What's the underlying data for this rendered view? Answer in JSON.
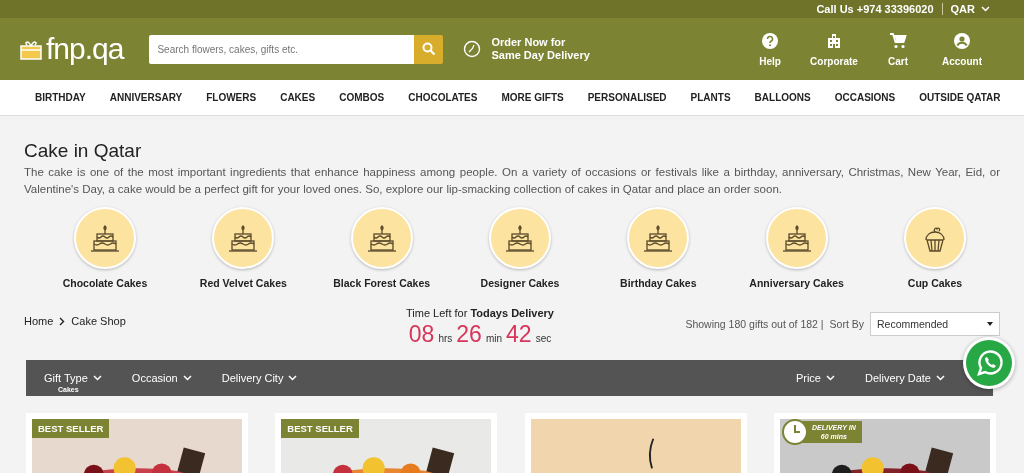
{
  "top_bar": {
    "call": "Call Us +974 33396020",
    "currency": "QAR"
  },
  "header": {
    "logo": "fnp.qa",
    "search": {
      "placeholder": "Search flowers, cakes, gifts etc."
    },
    "delivery_note": [
      "Order Now for",
      "Same Day Delivery"
    ],
    "actions": [
      {
        "kind": "help",
        "label": "Help"
      },
      {
        "kind": "corporate",
        "label": "Corporate"
      },
      {
        "kind": "cart",
        "label": "Cart"
      },
      {
        "kind": "account",
        "label": "Account"
      }
    ]
  },
  "nav": [
    "BIRTHDAY",
    "ANNIVERSARY",
    "FLOWERS",
    "CAKES",
    "COMBOS",
    "CHOCOLATES",
    "MORE GIFTS",
    "PERSONALISED",
    "PLANTS",
    "BALLOONS",
    "OCCASIONS",
    "OUTSIDE QATAR"
  ],
  "page": {
    "title": "Cake in Qatar",
    "description": "The cake is one of the most important ingredients that enhance happiness among people. On a variety of occasions or festivals like a birthday, anniversary, Christmas, New Year, Eid, or Valentine's Day, a cake would be a perfect gift for your loved ones. So, explore our lip-smacking collection of cakes in Qatar and place an order soon."
  },
  "categories": [
    {
      "label": "Chocolate Cakes",
      "kind": "cake"
    },
    {
      "label": "Red Velvet Cakes",
      "kind": "cake"
    },
    {
      "label": "Black Forest Cakes",
      "kind": "cake"
    },
    {
      "label": "Designer Cakes",
      "kind": "cake"
    },
    {
      "label": "Birthday Cakes",
      "kind": "cake"
    },
    {
      "label": "Anniversary Cakes",
      "kind": "cake"
    },
    {
      "label": "Cup Cakes",
      "kind": "cupcake"
    }
  ],
  "breadcrumb": [
    "Home",
    "Cake Shop"
  ],
  "timer": {
    "label": "Time Left for **Todays Delivery**",
    "parts": [
      {
        "value": "08",
        "unit": "hrs"
      },
      {
        "value": "26",
        "unit": "min"
      },
      {
        "value": "42",
        "unit": "sec"
      }
    ]
  },
  "results": {
    "count": "Showing 180 gifts out of 182 |",
    "sort_label": "Sort By",
    "sort_value": "Recommended"
  },
  "filters": {
    "left": [
      {
        "label": "Gift Type",
        "value": "Cakes"
      },
      {
        "label": "Occasion"
      },
      {
        "label": "Delivery City"
      }
    ],
    "right": [
      {
        "label": "Price"
      },
      {
        "label": "Delivery Date"
      }
    ]
  },
  "products": [
    {
      "badge": "BEST SELLER",
      "kind": "picture"
    },
    {
      "badge": "BEST SELLER",
      "kind": "picture"
    },
    {
      "kind": "picture"
    },
    {
      "delivery_badge": [
        "DELIVERY IN",
        "60 mins"
      ],
      "kind": "picture"
    }
  ]
}
